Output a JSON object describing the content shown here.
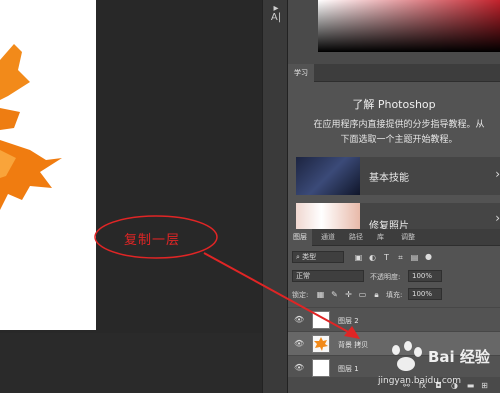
{
  "colors": {
    "annotation": "#e02525",
    "leaf": "#f28a1a"
  },
  "learn": {
    "tab": "学习",
    "title": "了解 Photoshop",
    "subtitle_line1": "在应用程序内直接提供的分步指导教程。从",
    "subtitle_line2": "下面选取一个主题开始教程。",
    "cards": [
      {
        "label": "基本技能",
        "icon": "chevron-right-icon"
      },
      {
        "label": "修复照片",
        "icon": "chevron-right-icon"
      }
    ]
  },
  "layers_panel": {
    "tabs": [
      "图层",
      "通道",
      "路径",
      "库",
      "调整"
    ],
    "filter_kind": "类型",
    "blend_mode": "正常",
    "opacity_label": "不透明度:",
    "opacity_value": "100%",
    "lock_label": "锁定:",
    "fill_label": "填充:",
    "fill_value": "100%",
    "layers": [
      {
        "name": "图层 2",
        "selected": false
      },
      {
        "name": "背景 拷贝",
        "selected": true
      },
      {
        "name": "图层 1",
        "selected": false
      }
    ]
  },
  "annotation": {
    "label": "复制一层"
  },
  "watermark": {
    "brand": "Bai 经验",
    "url": "jingyan.baidu.com"
  }
}
